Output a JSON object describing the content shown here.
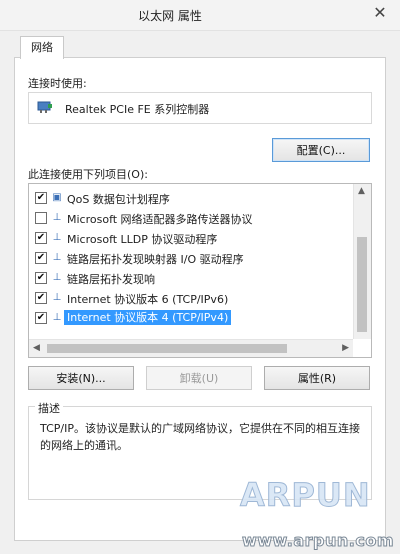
{
  "window": {
    "title": "以太网 属性",
    "close_glyph": "✕"
  },
  "tabs": [
    {
      "label": "网络"
    }
  ],
  "connect_using": {
    "label": "连接时使用:",
    "adapter": "Realtek PCIe FE 系列控制器",
    "configure_button": "配置(C)..."
  },
  "items_section": {
    "label": "此连接使用下列项目(O):",
    "items": [
      {
        "label": "QoS 数据包计划程序",
        "checked": true,
        "icon": "qos-icon"
      },
      {
        "label": "Microsoft 网络适配器多路传送器协议",
        "checked": false,
        "icon": "protocol-icon"
      },
      {
        "label": "Microsoft LLDP 协议驱动程序",
        "checked": true,
        "icon": "protocol-icon"
      },
      {
        "label": "链路层拓扑发现映射器 I/O 驱动程序",
        "checked": true,
        "icon": "protocol-icon"
      },
      {
        "label": "链路层拓扑发现响",
        "checked": true,
        "icon": "protocol-icon"
      },
      {
        "label": "Internet 协议版本 6 (TCP/IPv6)",
        "checked": true,
        "icon": "protocol-icon"
      },
      {
        "label": "Internet 协议版本 4 (TCP/IPv4)",
        "checked": true,
        "icon": "protocol-icon",
        "selected": true
      }
    ]
  },
  "buttons": {
    "install": "安装(N)...",
    "uninstall": "卸载(U)",
    "properties": "属性(R)"
  },
  "description": {
    "title": "描述",
    "text": "TCP/IP。该协议是默认的广域网络协议，它提供在不同的相互连接的网络上的通讯。"
  },
  "watermark": {
    "logo": "ARPUN",
    "url": "www.arpun.com"
  }
}
